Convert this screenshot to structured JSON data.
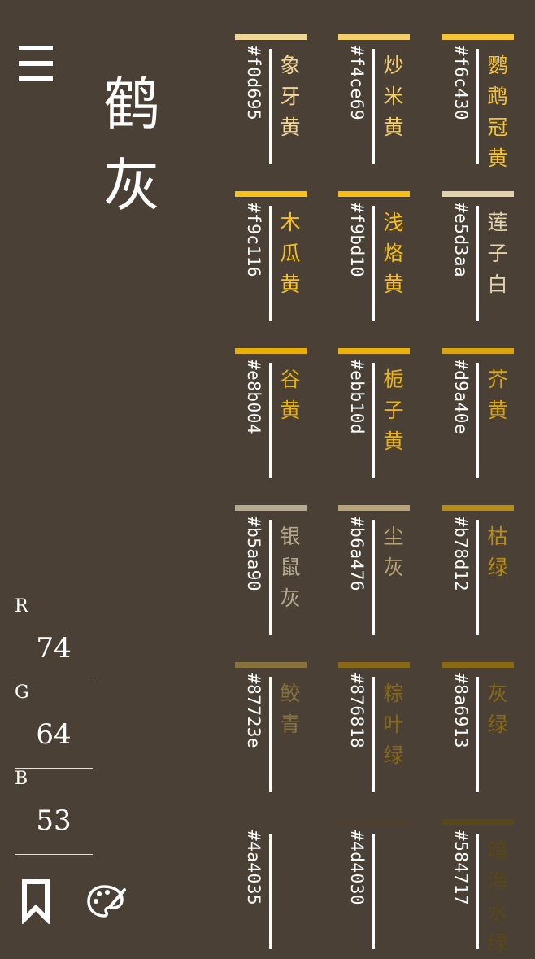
{
  "current": {
    "name": "鹤灰",
    "r": "74",
    "g": "64",
    "b": "53",
    "hex": "#4a4035"
  },
  "labels": {
    "r": "R",
    "g": "G",
    "b": "B"
  },
  "icons": {
    "menu": "menu-icon",
    "bookmark": "bookmark-icon",
    "palette": "palette-icon"
  },
  "colors": [
    {
      "name": "象牙黄",
      "hex": "#f0d695"
    },
    {
      "name": "炒米黄",
      "hex": "#f4ce69"
    },
    {
      "name": "鹦鹉冠黄",
      "hex": "#f6c430"
    },
    {
      "name": "木瓜黄",
      "hex": "#f9c116"
    },
    {
      "name": "浅烙黄",
      "hex": "#f9bd10"
    },
    {
      "name": "莲子白",
      "hex": "#e5d3aa"
    },
    {
      "name": "谷黄",
      "hex": "#e8b004"
    },
    {
      "name": "栀子黄",
      "hex": "#ebb10d"
    },
    {
      "name": "芥黄",
      "hex": "#d9a40e"
    },
    {
      "name": "银鼠灰",
      "hex": "#b5aa90"
    },
    {
      "name": "尘灰",
      "hex": "#b6a476"
    },
    {
      "name": "枯绿",
      "hex": "#b78d12"
    },
    {
      "name": "鲛青",
      "hex": "#87723e"
    },
    {
      "name": "粽叶绿",
      "hex": "#876818"
    },
    {
      "name": "灰绿",
      "hex": "#8a6913"
    },
    {
      "name": "",
      "hex": "#4a4035"
    },
    {
      "name": "",
      "hex": "#4d4030"
    },
    {
      "name": "暗海水绿",
      "hex": "#584717"
    }
  ]
}
